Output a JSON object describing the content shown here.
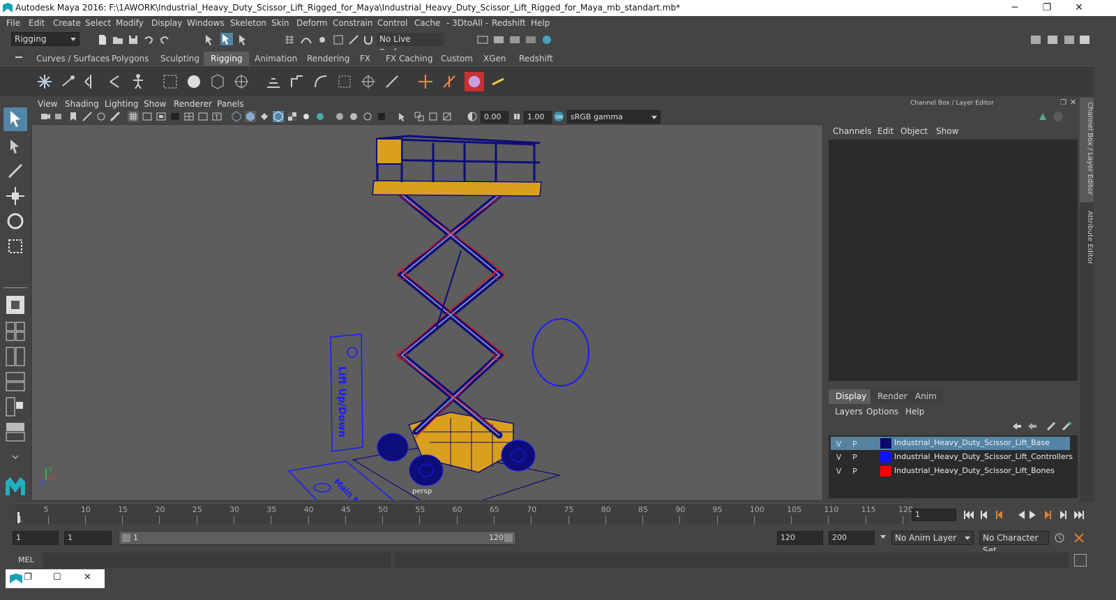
{
  "window": {
    "title": "Autodesk Maya 2016: F:\\1AWORK\\Industrial_Heavy_Duty_Scissor_Lift_Rigged_for_Maya\\Industrial_Heavy_Duty_Scissor_Lift_Rigged_for_Maya_mb_standart.mb*",
    "minimize": "─",
    "maximize": "❐",
    "close": "✕"
  },
  "menubar": [
    "File",
    "Edit",
    "Create",
    "Select",
    "Modify",
    "Display",
    "Windows",
    "Skeleton",
    "Skin",
    "Deform",
    "Constrain",
    "Control",
    "Cache",
    "- 3DtoAll -",
    "Redshift",
    "Help"
  ],
  "statusline": {
    "menuset": "Rigging",
    "live_surface": "No Live Surface"
  },
  "shelf_tabs": [
    "Curves / Surfaces",
    "Polygons",
    "Sculpting",
    "Rigging",
    "Animation",
    "Rendering",
    "FX",
    "FX Caching",
    "Custom",
    "XGen",
    "Redshift"
  ],
  "active_shelf_tab": "Rigging",
  "viewport": {
    "menu": [
      "View",
      "Shading",
      "Lighting",
      "Show",
      "Renderer",
      "Panels"
    ],
    "exposure": "0.00",
    "gamma": "1.00",
    "color_space": "sRGB gamma",
    "camera_label": "persp",
    "controller_text_1": "Lift Up/Down",
    "controller_text_2": "Main Move"
  },
  "channel_box": {
    "header": "Channel Box / Layer Editor",
    "menu": [
      "Channels",
      "Edit",
      "Object",
      "Show"
    ]
  },
  "side_tabs": [
    "Channel Box / Layer Editor",
    "Attribute Editor"
  ],
  "layer_editor": {
    "tabs": [
      "Display",
      "Render",
      "Anim"
    ],
    "active_tab": "Display",
    "menu": [
      "Layers",
      "Options",
      "Help"
    ],
    "layers": [
      {
        "v": "V",
        "p": "P",
        "name": "Industrial_Heavy_Duty_Scissor_Lift_Base",
        "color": "#0a0a6e",
        "selected": true
      },
      {
        "v": "V",
        "p": "P",
        "name": "Industrial_Heavy_Duty_Scissor_Lift_Controllers",
        "color": "#1010ff",
        "selected": false
      },
      {
        "v": "V",
        "p": "P",
        "name": "Industrial_Heavy_Duty_Scissor_Lift_Bones",
        "color": "#ff0000",
        "selected": false
      }
    ]
  },
  "timeline": {
    "ticks": [
      "5",
      "10",
      "15",
      "20",
      "25",
      "30",
      "35",
      "40",
      "45",
      "50",
      "55",
      "60",
      "65",
      "70",
      "75",
      "80",
      "85",
      "90",
      "95",
      "100",
      "105",
      "110",
      "115",
      "120"
    ],
    "start_tick": "1",
    "current_frame": "1"
  },
  "range": {
    "start": "1",
    "playback_start": "1",
    "slider_start": "1",
    "slider_end": "120",
    "playback_end": "120",
    "end": "200",
    "anim_layer": "No Anim Layer",
    "character_set": "No Character Set"
  },
  "command": {
    "label": "MEL"
  },
  "colors": {
    "accent": "#5285a6",
    "wire": "#0d0d7a",
    "bones": "#e01818",
    "controller": "#1a1aff",
    "body": "#d9a020"
  }
}
